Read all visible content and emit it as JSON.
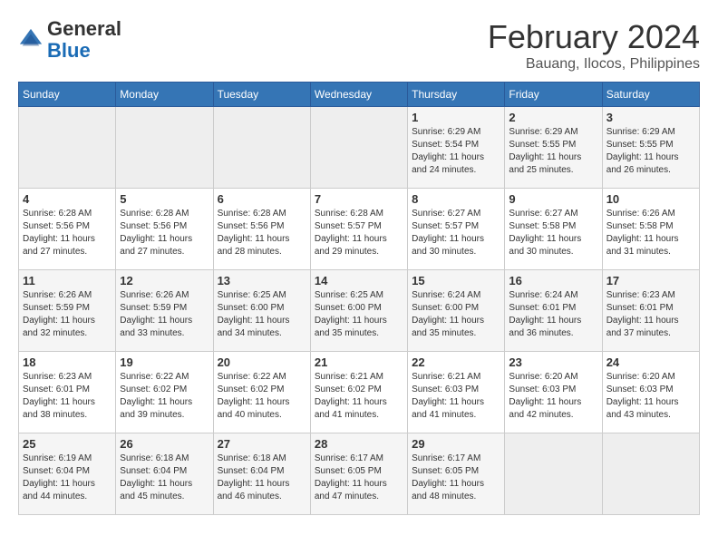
{
  "header": {
    "logo_general": "General",
    "logo_blue": "Blue",
    "month_year": "February 2024",
    "location": "Bauang, Ilocos, Philippines"
  },
  "weekdays": [
    "Sunday",
    "Monday",
    "Tuesday",
    "Wednesday",
    "Thursday",
    "Friday",
    "Saturday"
  ],
  "weeks": [
    [
      {
        "day": "",
        "info": ""
      },
      {
        "day": "",
        "info": ""
      },
      {
        "day": "",
        "info": ""
      },
      {
        "day": "",
        "info": ""
      },
      {
        "day": "1",
        "info": "Sunrise: 6:29 AM\nSunset: 5:54 PM\nDaylight: 11 hours\nand 24 minutes."
      },
      {
        "day": "2",
        "info": "Sunrise: 6:29 AM\nSunset: 5:55 PM\nDaylight: 11 hours\nand 25 minutes."
      },
      {
        "day": "3",
        "info": "Sunrise: 6:29 AM\nSunset: 5:55 PM\nDaylight: 11 hours\nand 26 minutes."
      }
    ],
    [
      {
        "day": "4",
        "info": "Sunrise: 6:28 AM\nSunset: 5:56 PM\nDaylight: 11 hours\nand 27 minutes."
      },
      {
        "day": "5",
        "info": "Sunrise: 6:28 AM\nSunset: 5:56 PM\nDaylight: 11 hours\nand 27 minutes."
      },
      {
        "day": "6",
        "info": "Sunrise: 6:28 AM\nSunset: 5:56 PM\nDaylight: 11 hours\nand 28 minutes."
      },
      {
        "day": "7",
        "info": "Sunrise: 6:28 AM\nSunset: 5:57 PM\nDaylight: 11 hours\nand 29 minutes."
      },
      {
        "day": "8",
        "info": "Sunrise: 6:27 AM\nSunset: 5:57 PM\nDaylight: 11 hours\nand 30 minutes."
      },
      {
        "day": "9",
        "info": "Sunrise: 6:27 AM\nSunset: 5:58 PM\nDaylight: 11 hours\nand 30 minutes."
      },
      {
        "day": "10",
        "info": "Sunrise: 6:26 AM\nSunset: 5:58 PM\nDaylight: 11 hours\nand 31 minutes."
      }
    ],
    [
      {
        "day": "11",
        "info": "Sunrise: 6:26 AM\nSunset: 5:59 PM\nDaylight: 11 hours\nand 32 minutes."
      },
      {
        "day": "12",
        "info": "Sunrise: 6:26 AM\nSunset: 5:59 PM\nDaylight: 11 hours\nand 33 minutes."
      },
      {
        "day": "13",
        "info": "Sunrise: 6:25 AM\nSunset: 6:00 PM\nDaylight: 11 hours\nand 34 minutes."
      },
      {
        "day": "14",
        "info": "Sunrise: 6:25 AM\nSunset: 6:00 PM\nDaylight: 11 hours\nand 35 minutes."
      },
      {
        "day": "15",
        "info": "Sunrise: 6:24 AM\nSunset: 6:00 PM\nDaylight: 11 hours\nand 35 minutes."
      },
      {
        "day": "16",
        "info": "Sunrise: 6:24 AM\nSunset: 6:01 PM\nDaylight: 11 hours\nand 36 minutes."
      },
      {
        "day": "17",
        "info": "Sunrise: 6:23 AM\nSunset: 6:01 PM\nDaylight: 11 hours\nand 37 minutes."
      }
    ],
    [
      {
        "day": "18",
        "info": "Sunrise: 6:23 AM\nSunset: 6:01 PM\nDaylight: 11 hours\nand 38 minutes."
      },
      {
        "day": "19",
        "info": "Sunrise: 6:22 AM\nSunset: 6:02 PM\nDaylight: 11 hours\nand 39 minutes."
      },
      {
        "day": "20",
        "info": "Sunrise: 6:22 AM\nSunset: 6:02 PM\nDaylight: 11 hours\nand 40 minutes."
      },
      {
        "day": "21",
        "info": "Sunrise: 6:21 AM\nSunset: 6:02 PM\nDaylight: 11 hours\nand 41 minutes."
      },
      {
        "day": "22",
        "info": "Sunrise: 6:21 AM\nSunset: 6:03 PM\nDaylight: 11 hours\nand 41 minutes."
      },
      {
        "day": "23",
        "info": "Sunrise: 6:20 AM\nSunset: 6:03 PM\nDaylight: 11 hours\nand 42 minutes."
      },
      {
        "day": "24",
        "info": "Sunrise: 6:20 AM\nSunset: 6:03 PM\nDaylight: 11 hours\nand 43 minutes."
      }
    ],
    [
      {
        "day": "25",
        "info": "Sunrise: 6:19 AM\nSunset: 6:04 PM\nDaylight: 11 hours\nand 44 minutes."
      },
      {
        "day": "26",
        "info": "Sunrise: 6:18 AM\nSunset: 6:04 PM\nDaylight: 11 hours\nand 45 minutes."
      },
      {
        "day": "27",
        "info": "Sunrise: 6:18 AM\nSunset: 6:04 PM\nDaylight: 11 hours\nand 46 minutes."
      },
      {
        "day": "28",
        "info": "Sunrise: 6:17 AM\nSunset: 6:05 PM\nDaylight: 11 hours\nand 47 minutes."
      },
      {
        "day": "29",
        "info": "Sunrise: 6:17 AM\nSunset: 6:05 PM\nDaylight: 11 hours\nand 48 minutes."
      },
      {
        "day": "",
        "info": ""
      },
      {
        "day": "",
        "info": ""
      }
    ]
  ]
}
